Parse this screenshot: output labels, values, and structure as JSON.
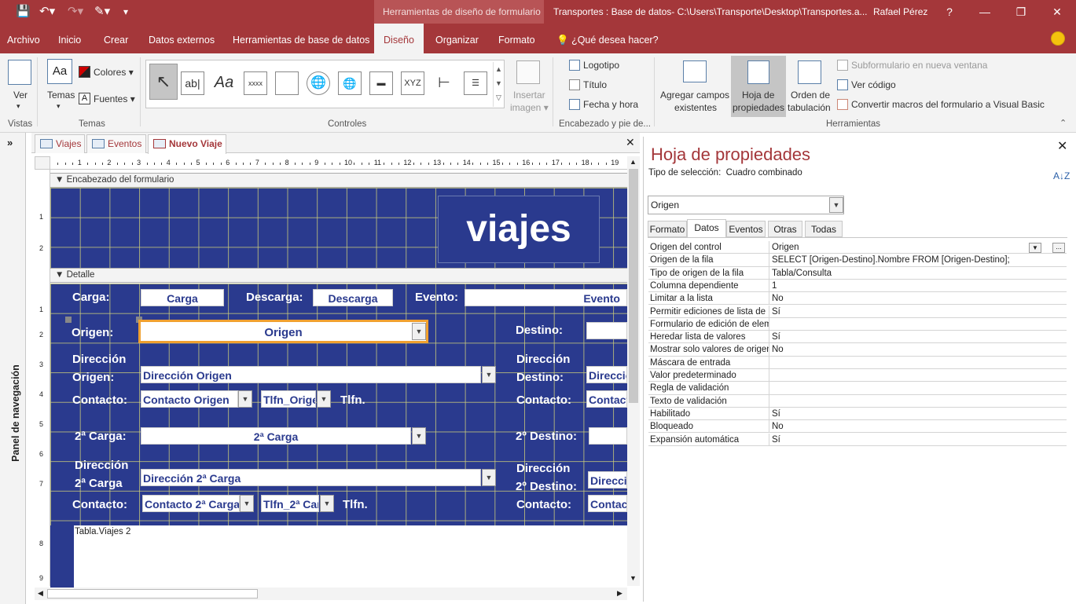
{
  "titlebar": {
    "context_group": "Herramientas de diseño de formulario",
    "title": "Transportes : Base de datos- C:\\Users\\Transporte\\Desktop\\Transportes.a...",
    "user": "Rafael Pérez",
    "help": "?"
  },
  "menu": {
    "tabs": [
      "Archivo",
      "Inicio",
      "Crear",
      "Datos externos",
      "Herramientas de base de datos",
      "Diseño",
      "Organizar",
      "Formato"
    ],
    "active": "Diseño",
    "tellme": "¿Qué desea hacer?"
  },
  "ribbon": {
    "vistas": {
      "ver": "Ver",
      "group": "Vistas"
    },
    "temas": {
      "temas": "Temas",
      "colores": "Colores",
      "fuentes": "Fuentes",
      "group": "Temas"
    },
    "controles": {
      "group": "Controles",
      "insertar1": "Insertar",
      "insertar2": "imagen"
    },
    "encabezado": {
      "logotipo": "Logotipo",
      "titulo": "Título",
      "fecha": "Fecha y hora",
      "group": "Encabezado y pie de..."
    },
    "herramientas": {
      "agregar1": "Agregar campos",
      "agregar2": "existentes",
      "hoja1": "Hoja de",
      "hoja2": "propiedades",
      "orden1": "Orden de",
      "orden2": "tabulación",
      "subform": "Subformulario en nueva ventana",
      "vercodigo": "Ver código",
      "convertir": "Convertir macros del formulario a Visual Basic",
      "group": "Herramientas"
    }
  },
  "navpane": {
    "label": "Panel de navegación"
  },
  "doctabs": [
    "Viajes",
    "Eventos",
    "Nuevo Viaje"
  ],
  "form": {
    "header_section": "Encabezado del formulario",
    "detail_section": "Detalle",
    "header_title": "viajes",
    "labels": {
      "carga": "Carga:",
      "descarga": "Descarga:",
      "evento": "Evento:",
      "origen": "Origen:",
      "destino": "Destino:",
      "dir_origen1": "Dirección",
      "dir_origen2": "Origen:",
      "dir_destino1": "Dirección",
      "dir_destino2": "Destino:",
      "contacto1": "Contacto:",
      "tlfn1": "Tlfn.",
      "contacto_dest1": "Contacto:",
      "carga2": "2ª Carga:",
      "destino2": "2º Destino:",
      "dir_carga2a": "Dirección",
      "dir_carga2b": "2ª Carga",
      "dir_destino2a": "Dirección",
      "dir_destino2b": "2º Destino:",
      "contacto2": "Contacto:",
      "tlfn2": "Tlfn.",
      "contacto_dest2": "Contacto:"
    },
    "fields": {
      "carga": "Carga",
      "descarga": "Descarga",
      "evento": "Evento",
      "origen": "Origen",
      "destino": "",
      "dir_origen": "Dirección Origen",
      "dir_destino": "Direcció",
      "contacto_origen": "Contacto Origen",
      "tlfn_origen": "Tlfn_Orige",
      "contacto_dest": "Contact",
      "carga2": "2ª Carga",
      "destino2": "",
      "dir_carga2": "Dirección 2ª Carga",
      "dir_destino2": "Direcci",
      "contacto_carga2": "Contacto 2ª Carga",
      "tlfn_carga2": "Tlfn_2ª Car",
      "contacto_dest2": "Contact"
    },
    "subform_label": "Tabla.Viajes 2"
  },
  "ruler_numbers": [
    "1",
    "2",
    "3",
    "4",
    "5",
    "6",
    "7",
    "8",
    "9",
    "10",
    "11",
    "12",
    "13",
    "14",
    "15",
    "16",
    "17",
    "18",
    "19"
  ],
  "vruler_numbers": [
    "1",
    "2",
    "1",
    "2",
    "3",
    "4",
    "5",
    "6",
    "7",
    "8",
    "9"
  ],
  "props": {
    "title": "Hoja de propiedades",
    "seltype_label": "Tipo de selección:",
    "seltype_value": "Cuadro combinado",
    "selector": "Origen",
    "tabs": [
      "Formato",
      "Datos",
      "Eventos",
      "Otras",
      "Todas"
    ],
    "active_tab": "Datos",
    "rows": [
      {
        "k": "Origen del control",
        "v": "Origen"
      },
      {
        "k": "Origen de la fila",
        "v": "SELECT [Origen-Destino].Nombre FROM [Origen-Destino];"
      },
      {
        "k": "Tipo de origen de la fila",
        "v": "Tabla/Consulta"
      },
      {
        "k": "Columna dependiente",
        "v": "1"
      },
      {
        "k": "Limitar a la lista",
        "v": "No"
      },
      {
        "k": "Permitir ediciones de lista de",
        "v": "Sí"
      },
      {
        "k": "Formulario de edición de elem",
        "v": ""
      },
      {
        "k": "Heredar lista de valores",
        "v": "Sí"
      },
      {
        "k": "Mostrar solo valores de origen",
        "v": "No"
      },
      {
        "k": "Máscara de entrada",
        "v": ""
      },
      {
        "k": "Valor predeterminado",
        "v": ""
      },
      {
        "k": "Regla de validación",
        "v": ""
      },
      {
        "k": "Texto de validación",
        "v": ""
      },
      {
        "k": "Habilitado",
        "v": "Sí"
      },
      {
        "k": "Bloqueado",
        "v": "No"
      },
      {
        "k": "Expansión automática",
        "v": "Sí"
      }
    ]
  },
  "colors": {
    "brand": "#a4373a",
    "form_bg": "#2a3a8e",
    "accent_select": "#f0a030"
  }
}
